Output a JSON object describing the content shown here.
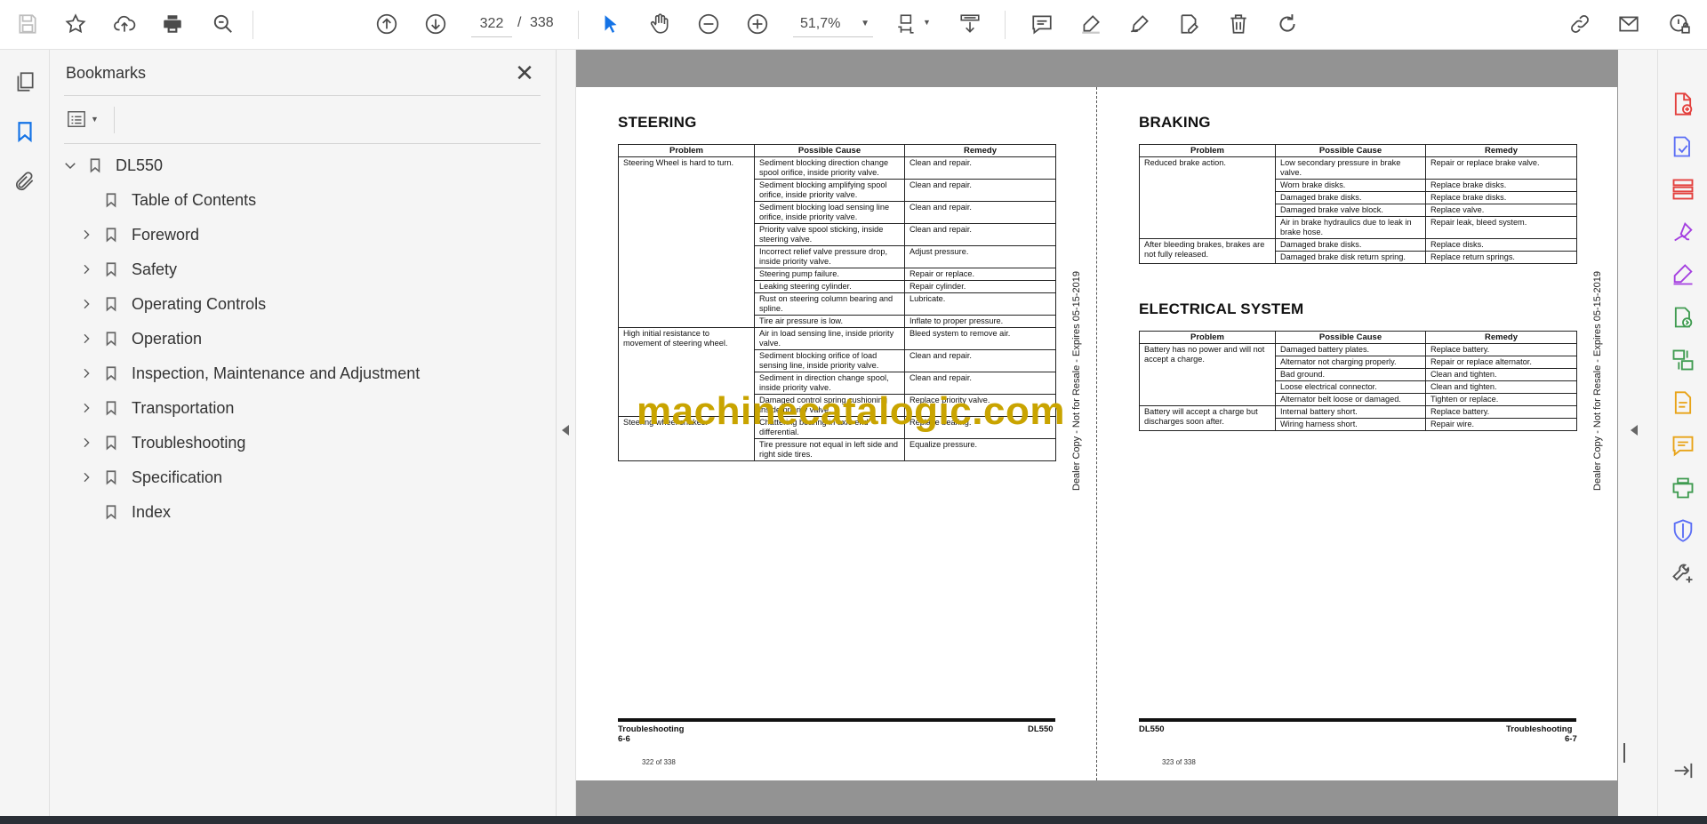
{
  "toolbar": {
    "page_current": "322",
    "page_separator": "/",
    "page_total": "338",
    "zoom": "51,7%",
    "icons": [
      "save-icon",
      "star-icon",
      "upload-cloud-icon",
      "print-icon",
      "zoom-search-icon",
      "page-up-icon",
      "page-down-icon",
      "select-cursor-icon",
      "hand-icon",
      "zoom-out-icon",
      "zoom-in-icon",
      "page-fit-icon",
      "scroll-mode-icon",
      "comment-icon",
      "highlight-icon",
      "draw-icon",
      "edit-text-icon",
      "delete-icon",
      "rotate-icon",
      "share-link-icon",
      "email-icon",
      "account-lock-icon"
    ]
  },
  "bookmarks": {
    "title": "Bookmarks",
    "root": "DL550",
    "items": [
      {
        "label": "Table of Contents",
        "expandable": false
      },
      {
        "label": "Foreword",
        "expandable": true
      },
      {
        "label": "Safety",
        "expandable": true
      },
      {
        "label": "Operating Controls",
        "expandable": true
      },
      {
        "label": "Operation",
        "expandable": true
      },
      {
        "label": "Inspection, Maintenance and Adjustment",
        "expandable": true
      },
      {
        "label": "Transportation",
        "expandable": true
      },
      {
        "label": "Troubleshooting",
        "expandable": true
      },
      {
        "label": "Specification",
        "expandable": true
      },
      {
        "label": "Index",
        "expandable": false
      }
    ]
  },
  "document": {
    "left_page": {
      "heading": "STEERING",
      "columns": [
        "Problem",
        "Possible Cause",
        "Remedy"
      ],
      "groups": [
        {
          "problem": "Steering Wheel is hard to turn.",
          "rows": [
            [
              "Sediment blocking direction change spool orifice, inside priority valve.",
              "Clean and repair."
            ],
            [
              "Sediment blocking amplifying spool orifice, inside priority valve.",
              "Clean and repair."
            ],
            [
              "Sediment blocking load sensing line orifice, inside priority valve.",
              "Clean and repair."
            ],
            [
              "Priority valve spool sticking, inside steering valve.",
              "Clean and repair."
            ],
            [
              "Incorrect relief valve pressure drop, inside priority valve.",
              "Adjust pressure."
            ],
            [
              "Steering pump failure.",
              "Repair or replace."
            ],
            [
              "Leaking steering cylinder.",
              "Repair cylinder."
            ],
            [
              "Rust on steering column bearing and spline.",
              "Lubricate."
            ],
            [
              "Tire air pressure is low.",
              "Inflate to proper pressure."
            ]
          ]
        },
        {
          "problem": "High initial resistance to movement of steering wheel.",
          "rows": [
            [
              "Air in load sensing line, inside priority valve.",
              "Bleed system to remove air."
            ],
            [
              "Sediment blocking orifice of load sensing line, inside priority valve.",
              "Clean and repair."
            ],
            [
              "Sediment in direction change spool, inside priority valve.",
              "Clean and repair."
            ],
            [
              "Damaged control spring cushioning inside priority valve.",
              "Replace priority valve."
            ]
          ]
        },
        {
          "problem": "Steering wheel shakes.",
          "rows": [
            [
              "Chattering bearing in axle end differential.",
              "Replace bearing."
            ],
            [
              "Tire pressure not equal in left side and right side tires.",
              "Equalize pressure."
            ]
          ]
        }
      ],
      "side_note": "Dealer Copy - Not for Resale - Expires 05-15-2019",
      "footer_left_title": "Troubleshooting",
      "footer_left_page": "6-6",
      "footer_right": "DL550",
      "page_counter": "322 of 338"
    },
    "right_page": {
      "braking": {
        "heading": "BRAKING",
        "columns": [
          "Problem",
          "Possible Cause",
          "Remedy"
        ],
        "groups": [
          {
            "problem": "Reduced brake action.",
            "rows": [
              [
                "Low secondary pressure in brake valve.",
                "Repair or replace brake valve."
              ],
              [
                "Worn brake disks.",
                "Replace brake disks."
              ],
              [
                "Damaged brake disks.",
                "Replace brake disks."
              ],
              [
                "Damaged brake valve block.",
                "Replace valve."
              ],
              [
                "Air in brake hydraulics due to leak in brake hose.",
                "Repair leak, bleed system."
              ]
            ]
          },
          {
            "problem": "After bleeding brakes, brakes are not fully released.",
            "rows": [
              [
                "Damaged brake disks.",
                "Replace disks."
              ],
              [
                "Damaged brake disk return spring.",
                "Replace return springs."
              ]
            ]
          }
        ]
      },
      "electrical": {
        "heading": "ELECTRICAL SYSTEM",
        "columns": [
          "Problem",
          "Possible Cause",
          "Remedy"
        ],
        "groups": [
          {
            "problem": "Battery has no power and will not accept a charge.",
            "rows": [
              [
                "Damaged battery plates.",
                "Replace battery."
              ],
              [
                "Alternator not charging properly.",
                "Repair or replace alternator."
              ],
              [
                "Bad ground.",
                "Clean and tighten."
              ],
              [
                "Loose electrical connector.",
                "Clean and tighten."
              ],
              [
                "Alternator belt loose or damaged.",
                "Tighten or replace."
              ]
            ]
          },
          {
            "problem": "Battery will accept a charge but discharges soon after.",
            "rows": [
              [
                "Internal battery short.",
                "Replace battery."
              ],
              [
                "Wiring harness short.",
                "Repair wire."
              ]
            ]
          }
        ]
      },
      "side_note": "Dealer Copy - Not for Resale - Expires 05-15-2019",
      "footer_left": "DL550",
      "footer_right_title": "Troubleshooting",
      "footer_right_page": "6-7",
      "page_counter": "323 of 338"
    },
    "watermark": "machinecatalogic.com"
  },
  "right_rail": {
    "icons": [
      "export-pdf-icon",
      "create-pdf-icon",
      "organize-pages-icon",
      "fill-sign-icon",
      "request-signature-icon",
      "combine-files-icon",
      "compare-files-icon",
      "scan-pdf-icon",
      "comment-tool-icon",
      "print-production-icon",
      "protect-icon",
      "more-tools-icon",
      "expand-panel-icon"
    ],
    "colors": [
      "#e3403d",
      "#5b6ef5",
      "#e3403d",
      "#a43fe0",
      "#a43fe0",
      "#3f9b50",
      "#3f9b50",
      "#e8a317",
      "#e8a317",
      "#3f9b50",
      "#5b6ef5",
      "#555555",
      "#555555"
    ]
  }
}
